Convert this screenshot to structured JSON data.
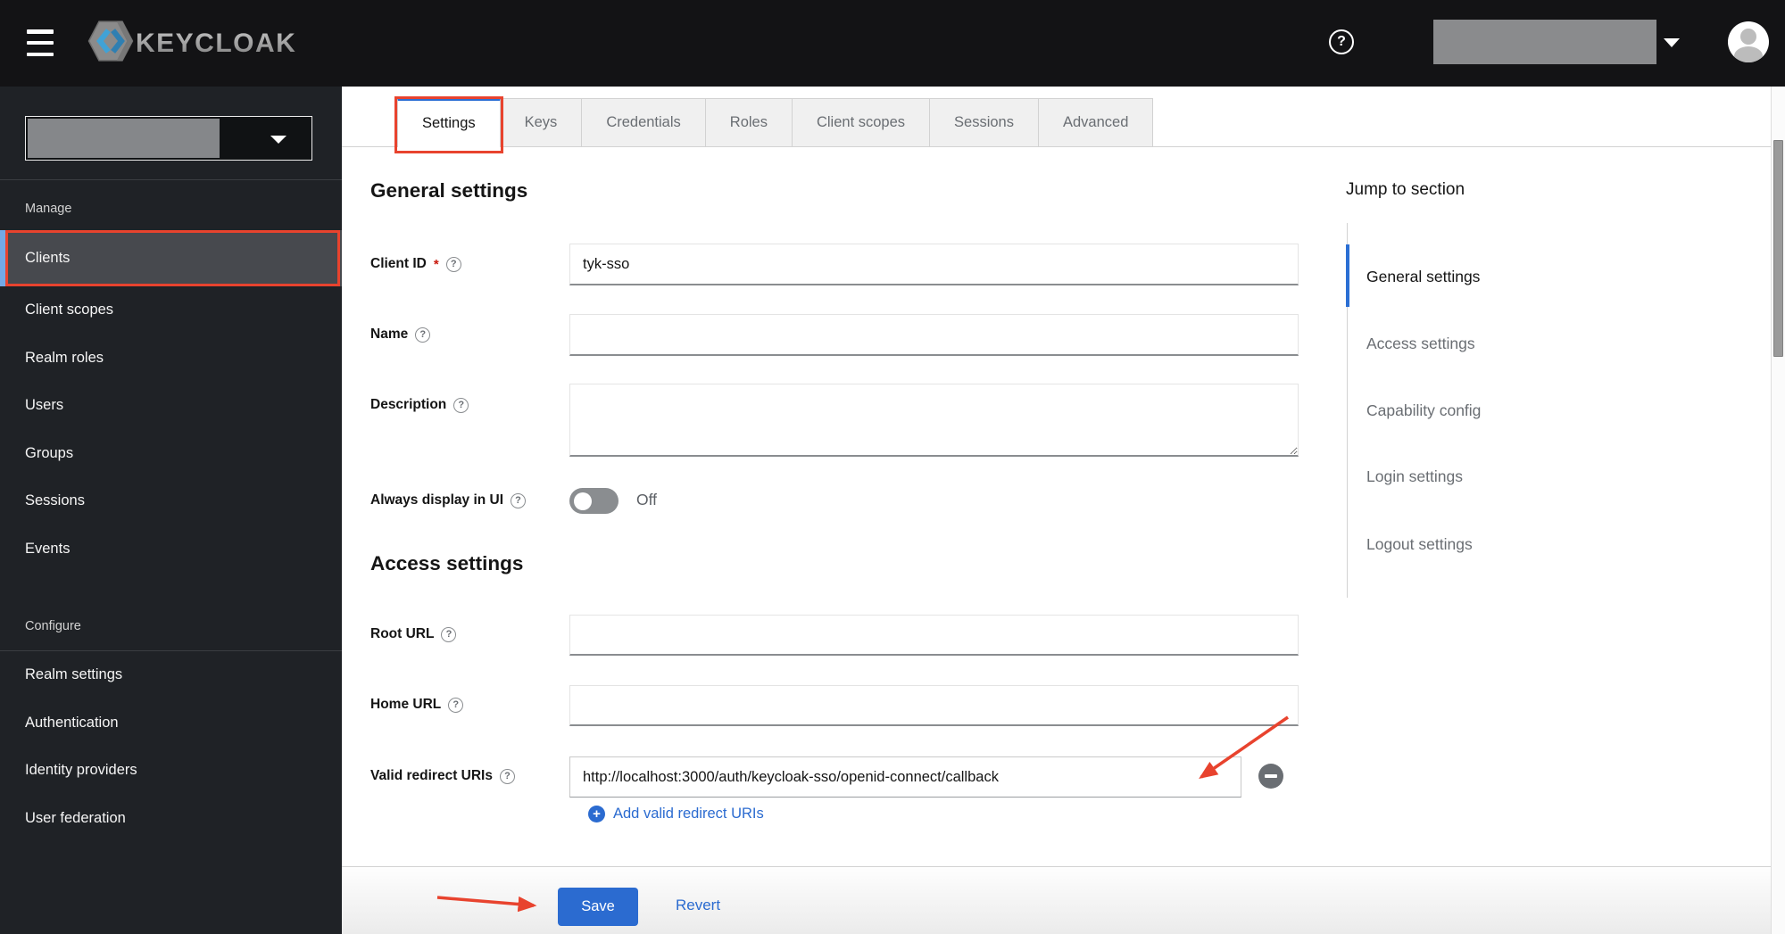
{
  "header": {
    "brand": "KEYCLOAK"
  },
  "icons": {
    "question": "?",
    "asterisk": "*",
    "plus": "+"
  },
  "sidebar": {
    "manage_label": "Manage",
    "manage_items": [
      "Clients",
      "Client scopes",
      "Realm roles",
      "Users",
      "Groups",
      "Sessions",
      "Events"
    ],
    "active_item": "Clients",
    "configure_label": "Configure",
    "configure_items": [
      "Realm settings",
      "Authentication",
      "Identity providers",
      "User federation"
    ]
  },
  "tabs": {
    "items": [
      "Settings",
      "Keys",
      "Credentials",
      "Roles",
      "Client scopes",
      "Sessions",
      "Advanced"
    ],
    "active": "Settings"
  },
  "form": {
    "general_heading": "General settings",
    "client_id": {
      "label": "Client ID",
      "required": true,
      "value": "tyk-sso"
    },
    "name": {
      "label": "Name",
      "value": ""
    },
    "description": {
      "label": "Description",
      "value": ""
    },
    "always_display": {
      "label": "Always display in UI",
      "state": "Off"
    },
    "access_heading": "Access settings",
    "root_url": {
      "label": "Root URL",
      "value": ""
    },
    "home_url": {
      "label": "Home URL",
      "value": ""
    },
    "valid_redirect_uris": {
      "label": "Valid redirect URIs",
      "value": "http://localhost:3000/auth/keycloak-sso/openid-connect/callback"
    },
    "add_redirect_label": "Add valid redirect URIs"
  },
  "footer": {
    "save_label": "Save",
    "revert_label": "Revert"
  },
  "jump_panel": {
    "title": "Jump to section",
    "items": [
      "General settings",
      "Access settings",
      "Capability config",
      "Login settings",
      "Logout settings"
    ],
    "active": "General settings"
  },
  "colors": {
    "annotation_red": "#e8432e",
    "primary_blue": "#2b6bd0",
    "tab_indicator_blue": "#2b6fd4",
    "nav_selected_strip": "#73a9e6",
    "topbar_bg": "#131315",
    "sidebar_bg": "#1f2226"
  }
}
